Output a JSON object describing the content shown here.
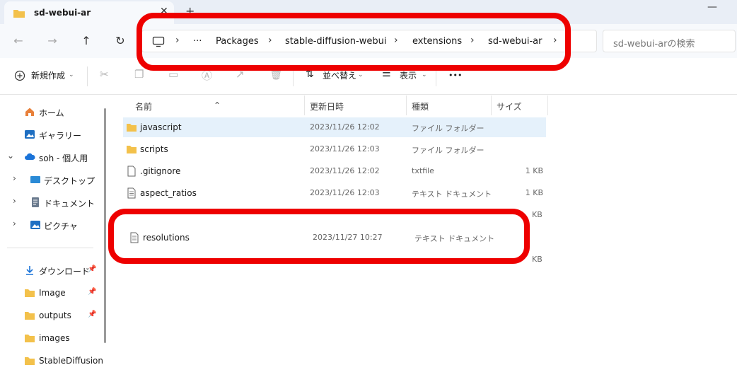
{
  "tab": {
    "title": "sd-webui-ar",
    "close": "✕",
    "new": "+"
  },
  "window": {
    "minimize": "—"
  },
  "nav": {
    "back": "←",
    "forward": "→",
    "up": "↑",
    "refresh": "↻"
  },
  "breadcrumb": {
    "more": "···",
    "items": [
      "Packages",
      "stable-diffusion-webui",
      "extensions",
      "sd-webui-ar"
    ],
    "sep": "›"
  },
  "search": {
    "placeholder": "sd-webui-arの検索"
  },
  "toolbar": {
    "new": "新規作成",
    "sort": "並べ替え",
    "view": "表示",
    "more": "•••"
  },
  "sidebar": {
    "items": [
      {
        "label": "ホーム"
      },
      {
        "label": "ギャラリー"
      },
      {
        "label": "soh - 個人用"
      },
      {
        "label": "デスクトップ"
      },
      {
        "label": "ドキュメント"
      },
      {
        "label": "ピクチャ"
      },
      {
        "label": "ダウンロード"
      },
      {
        "label": "Image"
      },
      {
        "label": "outputs"
      },
      {
        "label": "images"
      },
      {
        "label": "StableDiffusion"
      }
    ]
  },
  "columns": {
    "name": "名前",
    "date": "更新日時",
    "type": "種類",
    "size": "サイズ"
  },
  "files": [
    {
      "name": "javascript",
      "date": "2023/11/26 12:02",
      "type": "ファイル フォルダー",
      "size": ""
    },
    {
      "name": "scripts",
      "date": "2023/11/26 12:03",
      "type": "ファイル フォルダー",
      "size": ""
    },
    {
      "name": ".gitignore",
      "date": "2023/11/26 12:02",
      "type": "txtfile",
      "size": "1 KB"
    },
    {
      "name": "aspect_ratios",
      "date": "2023/11/26 12:03",
      "type": "テキスト ドキュメント",
      "size": "1 KB"
    },
    {
      "name": "resolutions",
      "date": "2023/11/27 10:27",
      "type": "テキスト ドキュメント",
      "size": ""
    }
  ],
  "hidden_sizes": [
    "KB",
    "KB"
  ],
  "colors": {
    "highlight": "#ee0000",
    "folder": "#f3c14b",
    "accent": "#0067c0"
  }
}
